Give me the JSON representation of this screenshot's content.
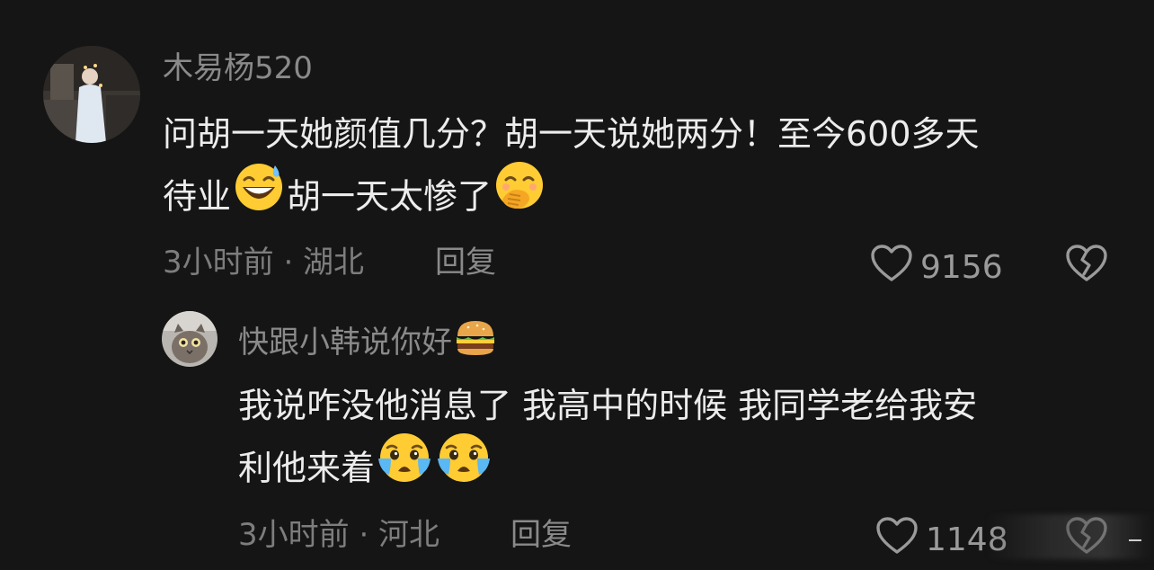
{
  "comments": [
    {
      "username": "木易杨520",
      "content_line1": "问胡一天她颜值几分？胡一天说她两分！至今600多天",
      "content_line2_a": "待业",
      "content_line2_b": "胡一天太惨了",
      "emoji_1": "grinning-sweat-emoji",
      "emoji_2": "hand-over-mouth-emoji",
      "time_location": "3小时前 · 湖北",
      "reply_label": "回复",
      "like_count": "9156"
    },
    {
      "username": "快跟小韩说你好",
      "username_emoji": "hamburger-emoji",
      "content_line1": "我说咋没他消息了 我高中的时候 我同学老给我安",
      "content_line2": "利他来着",
      "emoji_1": "crying-face-emoji",
      "emoji_2": "crying-face-emoji",
      "time_location": "3小时前 · 河北",
      "reply_label": "回复",
      "like_count": "1148"
    }
  ],
  "colors": {
    "background": "#151515",
    "username": "#8a8a8a",
    "content": "#ececec",
    "meta": "#7d7d7d"
  }
}
